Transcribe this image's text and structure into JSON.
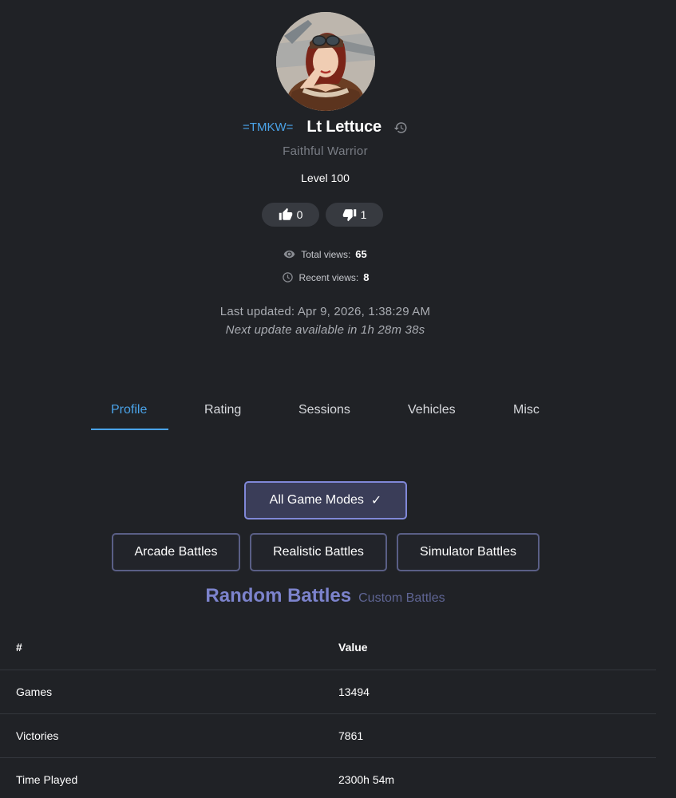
{
  "profile": {
    "clan_tag": "=TMKW=",
    "name": "Lt Lettuce",
    "title": "Faithful Warrior",
    "level": "Level 100",
    "upvotes": "0",
    "downvotes": "1",
    "total_views_label": "Total views:",
    "total_views": "65",
    "recent_views_label": "Recent views:",
    "recent_views": "8",
    "last_updated": "Last updated: Apr 9, 2026, 1:38:29 AM",
    "next_update": "Next update available in 1h 28m 38s"
  },
  "tabs": [
    {
      "label": "Profile",
      "active": true
    },
    {
      "label": "Rating"
    },
    {
      "label": "Sessions"
    },
    {
      "label": "Vehicles"
    },
    {
      "label": "Misc"
    }
  ],
  "modes": {
    "all": "All Game Modes",
    "check": "✓",
    "arcade": "Arcade Battles",
    "realistic": "Realistic Battles",
    "simulator": "Simulator Battles"
  },
  "battle_types": {
    "random": "Random Battles",
    "custom": "Custom Battles"
  },
  "table": {
    "headers": [
      "#",
      "Value"
    ],
    "rows": [
      [
        "Games",
        "13494"
      ],
      [
        "Victories",
        "7861"
      ],
      [
        "Time Played",
        "2300h 54m"
      ]
    ]
  },
  "colors": {
    "accent_blue": "#4aa3e8",
    "accent_purple": "#7c83cc",
    "background": "#202226"
  }
}
